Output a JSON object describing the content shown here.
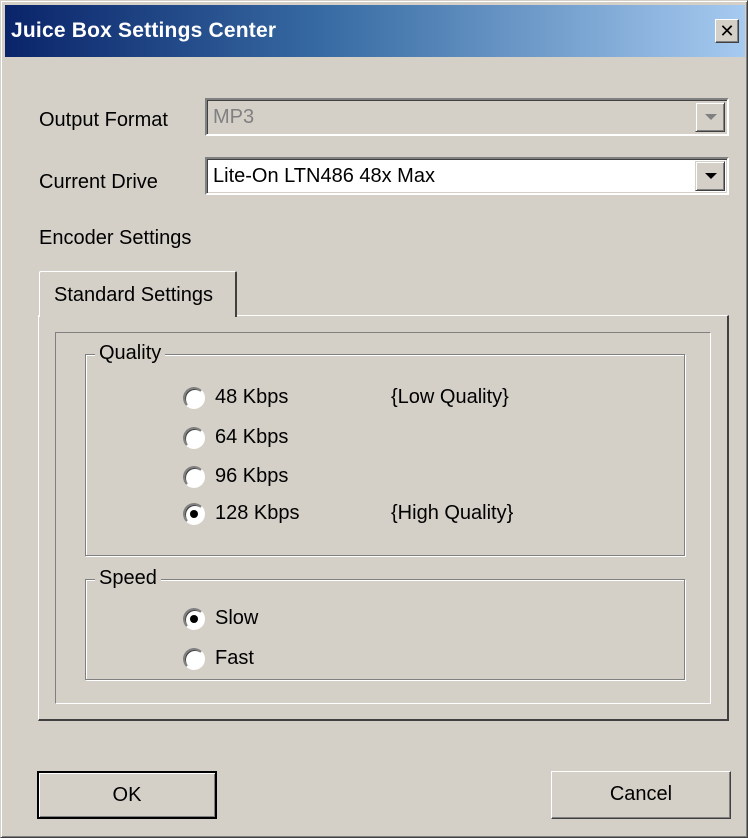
{
  "window": {
    "title": "Juice Box Settings Center",
    "close_glyph": "✕"
  },
  "output_format": {
    "label": "Output Format",
    "value": "MP3",
    "disabled": true
  },
  "current_drive": {
    "label": "Current Drive",
    "value": "Lite-On LTN486  48x Max"
  },
  "encoder": {
    "label": "Encoder Settings",
    "tab_label": "Standard Settings"
  },
  "quality": {
    "legend": "Quality",
    "options": [
      {
        "label": "48 Kbps",
        "note": "{Low Quality}",
        "checked": false
      },
      {
        "label": "64 Kbps",
        "note": "",
        "checked": false
      },
      {
        "label": "96 Kbps",
        "note": "",
        "checked": false
      },
      {
        "label": "128 Kbps",
        "note": "{High Quality}",
        "checked": true
      }
    ]
  },
  "speed": {
    "legend": "Speed",
    "options": [
      {
        "label": "Slow",
        "checked": true
      },
      {
        "label": "Fast",
        "checked": false
      }
    ]
  },
  "buttons": {
    "ok": "OK",
    "cancel": "Cancel"
  },
  "colors": {
    "face": "#d4d0c8",
    "title_start": "#0a246a",
    "title_end": "#a6caf0"
  }
}
